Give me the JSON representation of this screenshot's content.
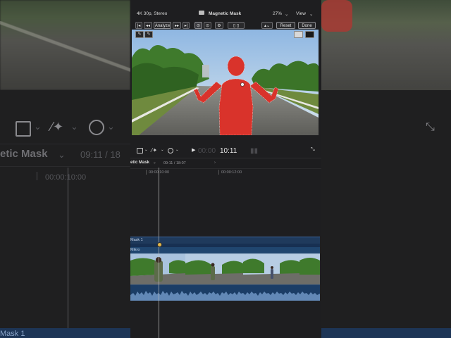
{
  "viewer_header": {
    "format": "4K 30p, Stereo",
    "title": "Magnetic Mask",
    "zoom": "27%",
    "view_menu": "View"
  },
  "mask_toolbar": {
    "analyze_label": "Analyze",
    "reset_label": "Reset",
    "done_label": "Done"
  },
  "transport": {
    "timecode_dim": "00:00",
    "timecode": "10:11"
  },
  "timeline_header": {
    "title": "etic Mask",
    "position": "09:11 / 18:07"
  },
  "ruler": {
    "tick_1": "00:00:10:00",
    "tick_2": "00:00:12:00"
  },
  "tracks": {
    "mask_label": "Mask 1",
    "video_label": "Mikro"
  },
  "background": {
    "title": "etic Mask",
    "position": "09:11 / 18",
    "ruler_tick": "00:00:10:00",
    "bottom_label": "Mask 1"
  },
  "colors": {
    "mask_red": "#d9332b",
    "track_blue": "#1f3a5c",
    "audio_wave": "#6f95c4"
  }
}
